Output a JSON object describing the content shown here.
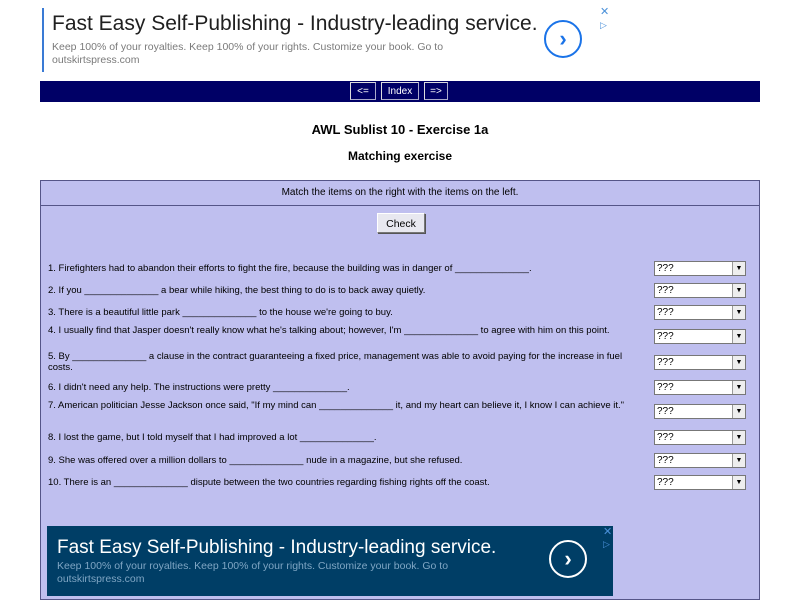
{
  "ad_top": {
    "title": "Fast Easy Self-Publishing - Industry-leading service.",
    "description": "Keep 100% of your royalties. Keep 100% of your rights. Customize your book. Go to outskirtspress.com",
    "arrow": "›",
    "close": "✕",
    "adchoices": "▷",
    "accent": "#1a73e8"
  },
  "nav": {
    "prev": "<=",
    "index": "Index",
    "next": "=>",
    "bg": "#000066"
  },
  "header": {
    "title": "AWL Sublist 10 - Exercise 1a",
    "subtitle": "Matching exercise"
  },
  "exercise": {
    "instructions": "Match the items on the right with the items on the left.",
    "check_label": "Check",
    "select_default": "???",
    "bg": "#bfbfef",
    "questions": [
      "1. Firefighters had to abandon their efforts to fight the fire, because the building was in danger of ______________.",
      "2. If you ______________ a bear while hiking, the best thing to do is to back away quietly.",
      "3. There is a beautiful little park ______________ to the house we're going to buy.",
      "4. I usually find that Jasper doesn't really know what he's talking about; however, I'm ______________ to agree with him on this point.",
      "5. By ______________ a clause in the contract guaranteeing a fixed price, management was able to avoid paying for the increase in fuel costs.",
      "6. I didn't need any help. The instructions were pretty ______________.",
      "7. American politician Jesse Jackson once said, \"If my mind can ______________ it, and my heart can believe it, I know I can achieve it.\"",
      "8. I lost the game, but I told myself that I had improved a lot ______________.",
      "9. She was offered over a million dollars to ______________ nude in a magazine, but she refused.",
      "10. There is an ______________ dispute between the two countries regarding fishing rights off the coast."
    ]
  },
  "ad_bottom": {
    "title": "Fast Easy Self-Publishing - Industry-leading service.",
    "description": "Keep 100% of your royalties. Keep 100% of your rights. Customize your book. Go to outskirtspress.com",
    "arrow": "›",
    "close": "✕",
    "adchoices": "▷",
    "bg": "#003e66"
  }
}
